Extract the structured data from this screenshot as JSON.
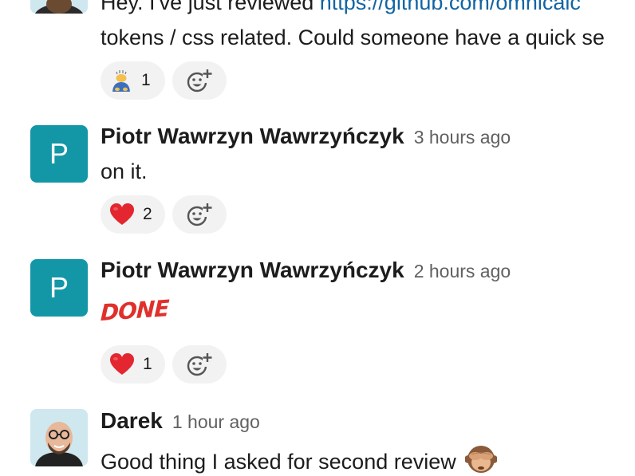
{
  "messages": [
    {
      "author": "",
      "time": "",
      "line1_prefix": "Hey. I've just reviewed ",
      "line1_link": "https://github.com/omnicalc",
      "line2": "tokens / css related. Could someone have a quick se",
      "reactions": [
        {
          "emoji": "bowing-person-emoji",
          "count": "1"
        }
      ]
    },
    {
      "avatar_letter": "P",
      "author": "Piotr Wawrzyn Wawrzyńczyk",
      "time": "3 hours ago",
      "text": "on it.",
      "reactions": [
        {
          "emoji": "red-heart-emoji",
          "count": "2"
        }
      ]
    },
    {
      "avatar_letter": "P",
      "author": "Piotr Wawrzyn Wawrzyńczyk",
      "time": "2 hours ago",
      "custom_emoji_text": "DONE",
      "reactions": [
        {
          "emoji": "red-heart-emoji",
          "count": "1"
        }
      ]
    },
    {
      "author": "Darek",
      "time": "1 hour ago",
      "text": "Good thing I asked for second review",
      "trailing_emoji": "see-no-evil-monkey-emoji"
    }
  ],
  "colors": {
    "avatar_teal": "#1397a6",
    "link_blue": "#1264a3",
    "reaction_bg": "#f2f2f2",
    "heart_red": "#e3262f",
    "done_red": "#e0302c",
    "timestamp_gray": "#616061"
  }
}
